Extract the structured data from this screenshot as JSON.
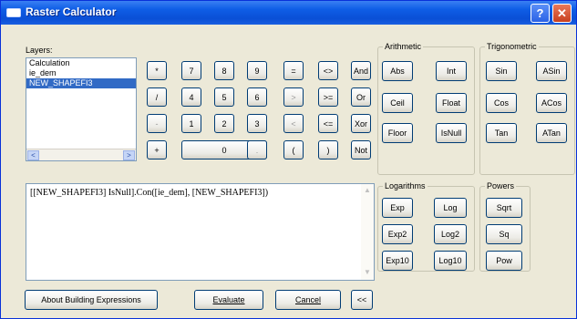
{
  "window": {
    "title": "Raster Calculator",
    "help_label": "?",
    "close_label": "✕"
  },
  "layers": {
    "label": "Layers:",
    "items": [
      "Calculation",
      "ie_dem",
      "NEW_SHAPEFI3"
    ],
    "selected_index": 2,
    "scroll_left": "<",
    "scroll_right": ">"
  },
  "keypad": {
    "row1": [
      "*",
      "7",
      "8",
      "9",
      "=",
      "<>",
      "And"
    ],
    "row2": [
      "/",
      "4",
      "5",
      "6",
      ">",
      ">=",
      "Or"
    ],
    "row3": [
      "-",
      "1",
      "2",
      "3",
      "<",
      "<=",
      "Xor"
    ],
    "row4": [
      "+",
      "0",
      ".",
      "(",
      ")",
      "Not"
    ]
  },
  "arithmetic": {
    "label": "Arithmetic",
    "buttons": [
      "Abs",
      "Int",
      "Ceil",
      "Float",
      "Floor",
      "IsNull"
    ]
  },
  "trigonometric": {
    "label": "Trigonometric",
    "buttons": [
      "Sin",
      "ASin",
      "Cos",
      "ACos",
      "Tan",
      "ATan"
    ]
  },
  "logarithms": {
    "label": "Logarithms",
    "buttons": [
      "Exp",
      "Log",
      "Exp2",
      "Log2",
      "Exp10",
      "Log10"
    ]
  },
  "powers": {
    "label": "Powers",
    "buttons": [
      "Sqrt",
      "Sq",
      "Pow"
    ]
  },
  "expression": {
    "value": "[[NEW_SHAPEFI3] IsNull].Con([ie_dem], [NEW_SHAPEFI3])"
  },
  "footer": {
    "about_label": "About Building Expressions",
    "evaluate_label": "Evaluate",
    "cancel_label": "Cancel",
    "collapse_label": "<<"
  }
}
